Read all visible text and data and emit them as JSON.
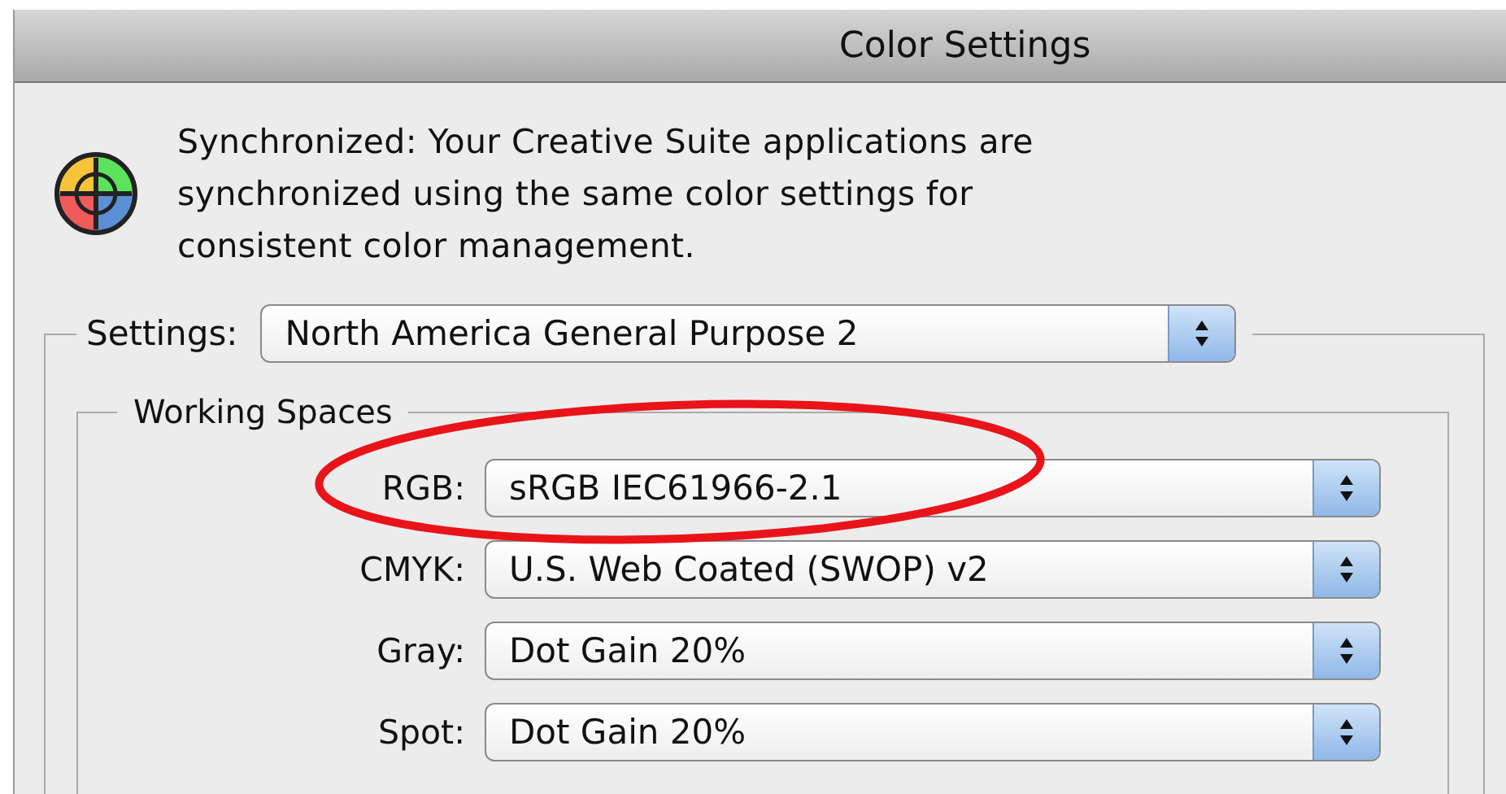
{
  "window": {
    "title": "Color Settings"
  },
  "sync_message": "Synchronized: Your Creative Suite applications are synchronized using the same color settings for consistent color management.",
  "settings": {
    "label": "Settings:",
    "value": "North America General Purpose 2"
  },
  "working_spaces": {
    "title": "Working Spaces",
    "rows": [
      {
        "label": "RGB:",
        "value": "sRGB IEC61966-2.1"
      },
      {
        "label": "CMYK:",
        "value": "U.S. Web Coated (SWOP) v2"
      },
      {
        "label": "Gray:",
        "value": "Dot Gain 20%"
      },
      {
        "label": "Spot:",
        "value": "Dot Gain 20%"
      }
    ]
  },
  "annotation": {
    "kind": "ellipse"
  }
}
